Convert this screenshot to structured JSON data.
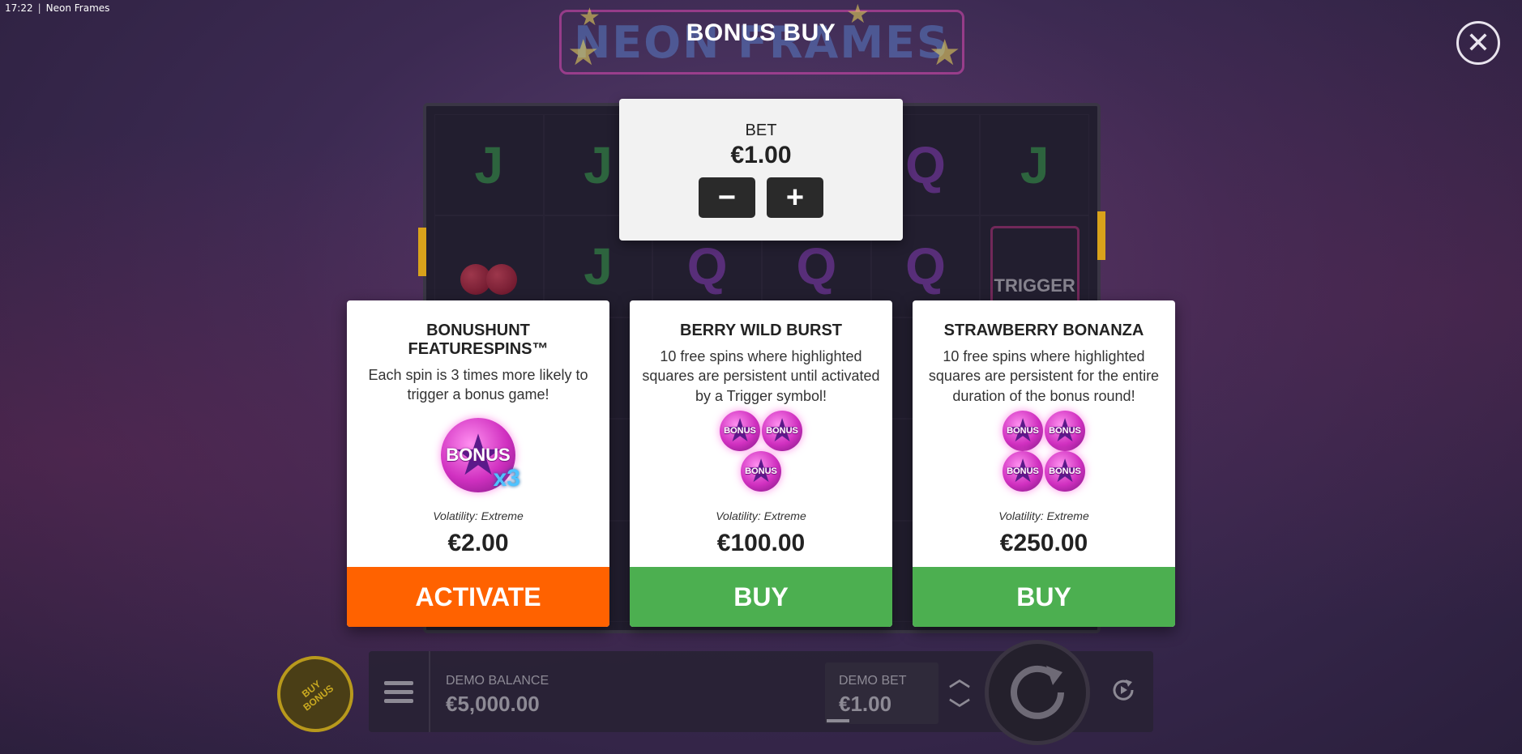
{
  "system": {
    "time": "17:22",
    "window_title": "Neon Frames"
  },
  "logo": {
    "text": "NEON FRAMES"
  },
  "dialog": {
    "title": "BONUS BUY",
    "close_icon": "close-icon"
  },
  "bet": {
    "label": "BET",
    "value": "€1.00",
    "minus": "−",
    "plus": "+"
  },
  "cards": [
    {
      "title": "BONUSHUNT FEATURESPINS™",
      "description": "Each spin is 3 times more likely to trigger a bonus game!",
      "badge_text": "BONUS",
      "multiplier": "x3",
      "volatility": "Volatility: Extreme",
      "price": "€2.00",
      "action": "ACTIVATE",
      "action_color": "#ff6200"
    },
    {
      "title": "BERRY WILD BURST",
      "description": "10 free spins where highlighted squares are persistent until activated by a Trigger symbol!",
      "badge_text": "BONUS",
      "volatility": "Volatility: Extreme",
      "price": "€100.00",
      "action": "BUY",
      "action_color": "#4caf50"
    },
    {
      "title": "STRAWBERRY BONANZA",
      "description": "10 free spins where highlighted squares are persistent for the entire duration of the bonus round!",
      "badge_text": "BONUS",
      "volatility": "Volatility: Extreme",
      "price": "€250.00",
      "action": "BUY",
      "action_color": "#4caf50"
    }
  ],
  "bottom": {
    "buy_bonus": "BUY BONUS",
    "balance_label": "DEMO BALANCE",
    "balance_value": "€5,000.00",
    "demo_bet_label": "DEMO BET",
    "demo_bet_value": "€1.00"
  },
  "reel_symbols": {
    "trigger_label": "TRIGGER"
  }
}
